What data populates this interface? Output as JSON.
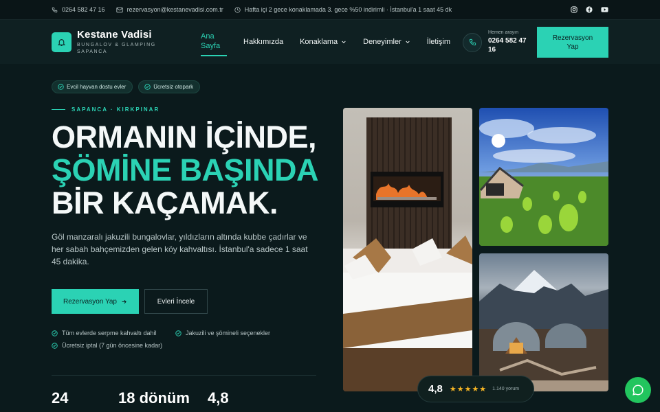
{
  "topbar": {
    "phone": "0264 582 47 16",
    "email": "rezervasyon@kestanevadisi.com.tr",
    "promo": "Hafta içi 2 gece konaklamada 3. gece %50 indirimli · İstanbul'a 1 saat 45 dk",
    "socials": [
      "instagram-icon",
      "facebook-icon",
      "youtube-icon"
    ]
  },
  "brand": {
    "name": "Kestane Vadisi",
    "tagline_1": "BUNGALOV & GLAMPING",
    "tagline_2": "SAPANCA",
    "accent": "#2bd2b4"
  },
  "nav": {
    "items": [
      {
        "label": "Ana Sayfa"
      },
      {
        "label": "Hakkımızda"
      },
      {
        "label": "Konaklama"
      },
      {
        "label": "Deneyimler"
      },
      {
        "label": "İletişim"
      }
    ]
  },
  "call": {
    "label": "Hemen arayın",
    "number": "0264 582 47 16"
  },
  "header_cta": "Rezervasyon Yap",
  "badges": [
    "Evcil hayvan dostu evler",
    "Ücretsiz otopark"
  ],
  "hero": {
    "eyebrow": "SAPANCA · KIRKPINAR",
    "line_1": "ORMANIN İÇİNDE,",
    "line_2": "ŞÖMİNE BAŞINDA",
    "line_3": "BİR KAÇAMAK.",
    "lead": "Göl manzaralı jakuzili bungalovlar, yıldızların altında kubbe çadırlar ve her sabah bahçemizden gelen köy kahvaltısı. İstanbul'a sadece 1 saat 45 dakika.",
    "primary_cta": "Rezervasyon Yap",
    "secondary_cta": "Evleri İncele",
    "perks": [
      "Tüm evlerde serpme kahvaltı dahil",
      "Jakuzili ve şömineli seçenekler",
      "Ücretsiz iptal (7 gün öncesine kadar)"
    ],
    "stats": [
      "24",
      "18 dönüm",
      "4,8"
    ]
  },
  "rating": {
    "value": "4,8",
    "stars": "★★★★★",
    "count": "1.140 yorum"
  }
}
